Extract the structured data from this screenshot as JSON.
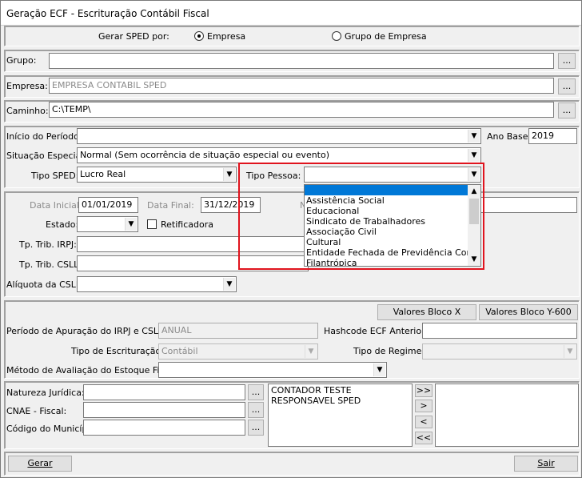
{
  "window": {
    "title": "Geração ECF - Escrituração Contábil Fiscal"
  },
  "gerar_sped": {
    "label": "Gerar SPED por:",
    "opt_empresa": "Empresa",
    "opt_grupo": "Grupo de Empresa"
  },
  "grupo": {
    "label": "Grupo:",
    "value": "",
    "btn": "..."
  },
  "empresa": {
    "label": "Empresa:",
    "value": "EMPRESA CONTABIL SPED",
    "btn": "..."
  },
  "caminho": {
    "label": "Caminho:",
    "value": "C:\\TEMP\\",
    "btn": "..."
  },
  "periodo": {
    "inicio_label": "Início do Período:",
    "inicio_value": "",
    "ano_base_label": "Ano Base:",
    "ano_base_value": "2019",
    "situacao_label": "Situação Especial:",
    "situacao_value": "Normal (Sem ocorrência de situação especial ou evento)",
    "tipo_sped_label": "Tipo SPED:",
    "tipo_sped_value": "Lucro Real",
    "tipo_pessoa_label": "Tipo Pessoa:",
    "tipo_pessoa_value": ""
  },
  "tipo_pessoa_options": [
    "",
    "Assistência Social",
    "Educacional",
    "Sindicato de Trabalhadores",
    "Associação Civil",
    "Cultural",
    "Entidade Fechada de Previdência Complem",
    "Filantrópica"
  ],
  "datas": {
    "inicial_label": "Data Inicial:",
    "inicial_value": "01/01/2019",
    "final_label": "Data Final:",
    "final_value": "31/12/2019",
    "n_label": "N",
    "estado_label": "Estado:",
    "estado_value": "",
    "retificadora_label": "Retificadora",
    "irpj_label": "Tp. Trib. IRPJ:",
    "csll_label": "Tp. Trib. CSLL:",
    "aliquota_label": "Alíquota da CSLL:"
  },
  "blocos": {
    "btn_x": "Valores Bloco X",
    "btn_y600": "Valores Bloco Y-600",
    "periodo_apuracao_label": "Período de Apuração do IRPJ e CSLL:",
    "periodo_apuracao_value": "ANUAL",
    "hashcode_label": "Hashcode ECF Anterior:",
    "hashcode_value": "",
    "tipo_escrituracao_label": "Tipo de Escrituração:",
    "tipo_escrituracao_value": "Contábil",
    "tipo_regime_label": "Tipo de Regime:",
    "tipo_regime_value": "",
    "metodo_label": "Método de Avaliação do Estoque Final:",
    "metodo_value": ""
  },
  "natureza": {
    "natureza_label": "Natureza Jurídica:",
    "cnae_label": "CNAE - Fiscal:",
    "municipio_label": "Código do Município:",
    "btn": "..."
  },
  "responsaveis": [
    "CONTADOR TESTE",
    "RESPONSAVEL SPED"
  ],
  "transfer_buttons": [
    ">>",
    ">",
    "<",
    "<<"
  ],
  "footer": {
    "gerar": "Gerar",
    "sair": "Sair"
  }
}
